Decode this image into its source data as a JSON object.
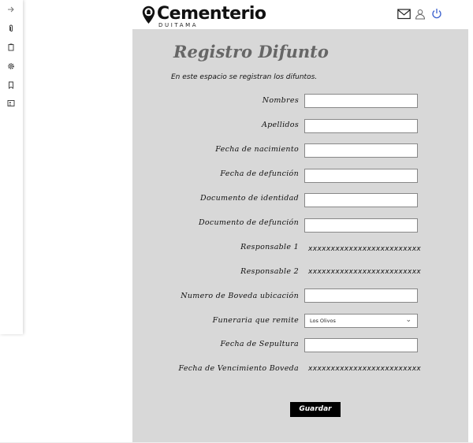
{
  "brand": {
    "title": "Cementerio",
    "subtitle": "DUITAMA"
  },
  "sidebar": {
    "icons": [
      "arrow-right-icon",
      "paperclip-icon",
      "clipboard-icon",
      "gear-icon",
      "bookmark-icon",
      "id-card-icon"
    ]
  },
  "topbar": {
    "icons": [
      "mail-icon",
      "user-icon",
      "power-icon"
    ]
  },
  "form": {
    "title": "Registro Difunto",
    "intro": "En este espacio se registran los difuntos.",
    "nombres_label": "Nombres",
    "apellidos_label": "Apellidos",
    "nacimiento_label": "Fecha de nacimiento",
    "defuncion_label": "Fecha de defunción",
    "documento_label": "Documento de identidad",
    "doc_defuncion_label": "Documento de defunción",
    "responsable1_label": "Responsable 1",
    "responsable1_value": "xxxxxxxxxxxxxxxxxxxxxxxxx",
    "responsable2_label": "Responsable 2",
    "responsable2_value": "xxxxxxxxxxxxxxxxxxxxxxxxx",
    "boveda_label": "Numero de Boveda ubicación",
    "funeraria_label": "Funeraria que remite",
    "funeraria_value": "Los Olivos",
    "sepultura_label": "Fecha de Sepultura",
    "vencimiento_label": "Fecha de Vencimiento Boveda",
    "vencimiento_value": "xxxxxxxxxxxxxxxxxxxxxxxxx",
    "save_label": "Guardar"
  }
}
